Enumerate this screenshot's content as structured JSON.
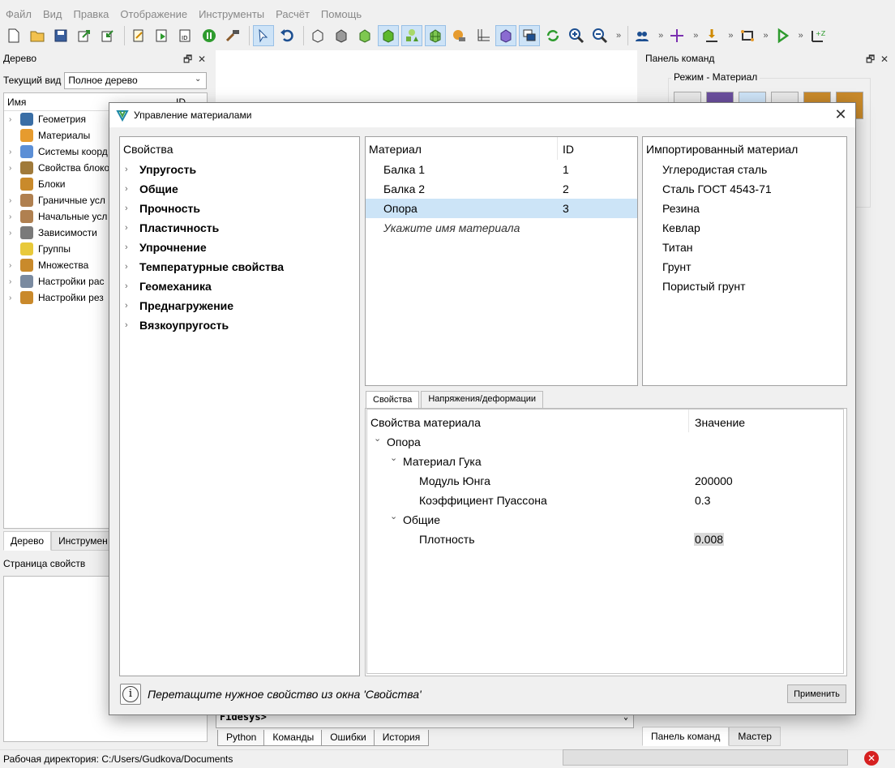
{
  "menu": [
    "Файл",
    "Вид",
    "Правка",
    "Отображение",
    "Инструменты",
    "Расчёт",
    "Помощь"
  ],
  "left_dock": {
    "title": "Дерево",
    "current_view_label": "Текущий вид",
    "current_view_value": "Полное дерево",
    "tree_header": "Имя",
    "tree_header_id": "ID",
    "items": [
      {
        "label": "Геометрия",
        "icon": "geometry-icon",
        "expandable": true
      },
      {
        "label": "Материалы",
        "icon": "materials-icon",
        "expandable": false
      },
      {
        "label": "Системы коорд",
        "icon": "coord-systems-icon",
        "expandable": true
      },
      {
        "label": "Свойства блоко",
        "icon": "block-props-icon",
        "expandable": true
      },
      {
        "label": "Блоки",
        "icon": "blocks-icon",
        "expandable": false
      },
      {
        "label": "Граничные усл",
        "icon": "boundary-conditions-icon",
        "expandable": true
      },
      {
        "label": "Начальные усл",
        "icon": "initial-conditions-icon",
        "expandable": true
      },
      {
        "label": "Зависимости",
        "icon": "dependencies-icon",
        "expandable": true
      },
      {
        "label": "Группы",
        "icon": "groups-icon",
        "expandable": false
      },
      {
        "label": "Множества",
        "icon": "sets-icon",
        "expandable": true
      },
      {
        "label": "Настройки рас",
        "icon": "calc-settings-icon",
        "expandable": true
      },
      {
        "label": "Настройки рез",
        "icon": "result-settings-icon",
        "expandable": true
      }
    ],
    "tabs": [
      "Дерево",
      "Инструмен"
    ],
    "props_title": "Страница свойств"
  },
  "right_dock": {
    "title": "Панель команд",
    "group_label": "Режим - Материал",
    "tabs": [
      "Панель команд",
      "Мастер"
    ]
  },
  "console": {
    "prompt": "Fidesys>",
    "tabs": [
      "Python",
      "Команды",
      "Ошибки",
      "История"
    ]
  },
  "status": {
    "working_dir": "Рабочая директория: C:/Users/Gudkova/Documents"
  },
  "dialog": {
    "title": "Управление материалами",
    "properties_header": "Свойства",
    "property_groups": [
      "Упругость",
      "Общие",
      "Прочность",
      "Пластичность",
      "Упрочнение",
      "Температурные свойства",
      "Геомеханика",
      "Преднагружение",
      "Вязкоупругость"
    ],
    "materials_header": "Материал",
    "materials_id_header": "ID",
    "materials": [
      {
        "name": "Балка 1",
        "id": "1",
        "selected": false
      },
      {
        "name": "Балка 2",
        "id": "2",
        "selected": false
      },
      {
        "name": "Опора",
        "id": "3",
        "selected": true
      }
    ],
    "materials_placeholder": "Укажите имя материала",
    "imported_header": "Импортированный материал",
    "imported": [
      "Углеродистая сталь",
      "Сталь ГОСТ 4543-71",
      "Резина",
      "Кевлар",
      "Титан",
      "Грунт",
      "Пористый грунт"
    ],
    "lower_tabs": [
      "Свойства",
      "Напряжения/деформации"
    ],
    "material_props_header": "Свойства материала",
    "value_header": "Значение",
    "material_props": [
      {
        "label": "Опора",
        "value": "",
        "level": 0,
        "expanded": true
      },
      {
        "label": "Материал Гука",
        "value": "",
        "level": 1,
        "expanded": true
      },
      {
        "label": "Модуль Юнга",
        "value": "200000",
        "level": 2
      },
      {
        "label": "Коэффициент Пуассона",
        "value": "0.3",
        "level": 2
      },
      {
        "label": "Общие",
        "value": "",
        "level": 1,
        "expanded": true
      },
      {
        "label": "Плотность",
        "value": "0.008",
        "level": 2,
        "highlight": true
      }
    ],
    "hint": "Перетащите нужное свойство из окна 'Свойства'",
    "apply_label": "Применить"
  },
  "colors": {
    "selection": "#cce4f7",
    "accent": "#2e7d32",
    "stop": "#d62020"
  }
}
